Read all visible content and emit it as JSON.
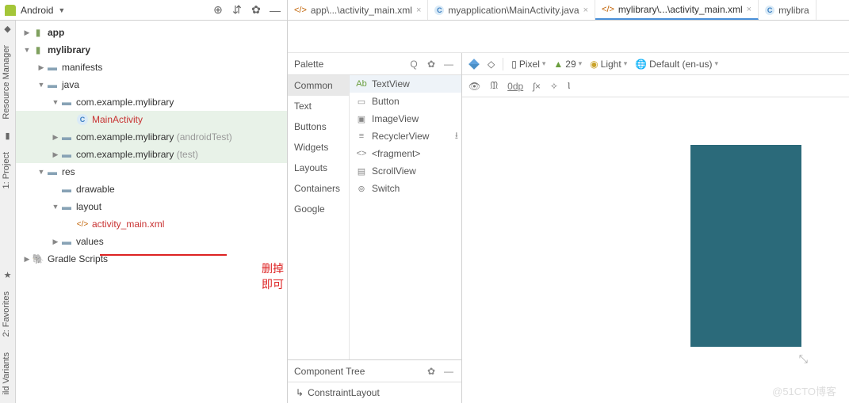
{
  "header": {
    "project_dropdown": "Android"
  },
  "editor_tabs": [
    {
      "icon": "xml",
      "label": "app\\...\\activity_main.xml"
    },
    {
      "icon": "java",
      "label": "myapplication\\MainActivity.java"
    },
    {
      "icon": "xml",
      "label": "mylibrary\\...\\activity_main.xml",
      "active": true
    },
    {
      "icon": "java",
      "label": "mylibra"
    }
  ],
  "side_rail": {
    "tabs": [
      "Resource Manager",
      "1: Project",
      "2: Favorites",
      "ild Variants"
    ]
  },
  "tree": {
    "app": "app",
    "mylibrary": "mylibrary",
    "manifests": "manifests",
    "java": "java",
    "pkg1": "com.example.mylibrary",
    "main_activity": "MainActivity",
    "pkg2_a": "com.example.mylibrary",
    "pkg2_b": "(androidTest)",
    "pkg3_a": "com.example.mylibrary",
    "pkg3_b": "(test)",
    "res": "res",
    "drawable": "drawable",
    "layout": "layout",
    "activity_main": "activity_main.xml",
    "values": "values",
    "gradle": "Gradle Scripts"
  },
  "annotation": "删掉即可",
  "palette": {
    "title": "Palette",
    "categories": [
      "Common",
      "Text",
      "Buttons",
      "Widgets",
      "Layouts",
      "Containers",
      "Google"
    ],
    "selected_category": "Common",
    "items": [
      {
        "icon": "Ab",
        "label": "TextView",
        "sel": true
      },
      {
        "icon": "▭",
        "label": "Button"
      },
      {
        "icon": "▣",
        "label": "ImageView"
      },
      {
        "icon": "≡",
        "label": "RecyclerView",
        "dl": true
      },
      {
        "icon": "<>",
        "label": "<fragment>"
      },
      {
        "icon": "▤",
        "label": "ScrollView"
      },
      {
        "icon": "⊚",
        "label": "Switch"
      }
    ]
  },
  "component_tree": {
    "title": "Component Tree",
    "root": "ConstraintLayout"
  },
  "design_toolbar": {
    "device": "Pixel",
    "api": "29",
    "theme": "Light",
    "locale": "Default (en-us)",
    "margin": "0dp"
  },
  "watermark": "@51CTO博客"
}
